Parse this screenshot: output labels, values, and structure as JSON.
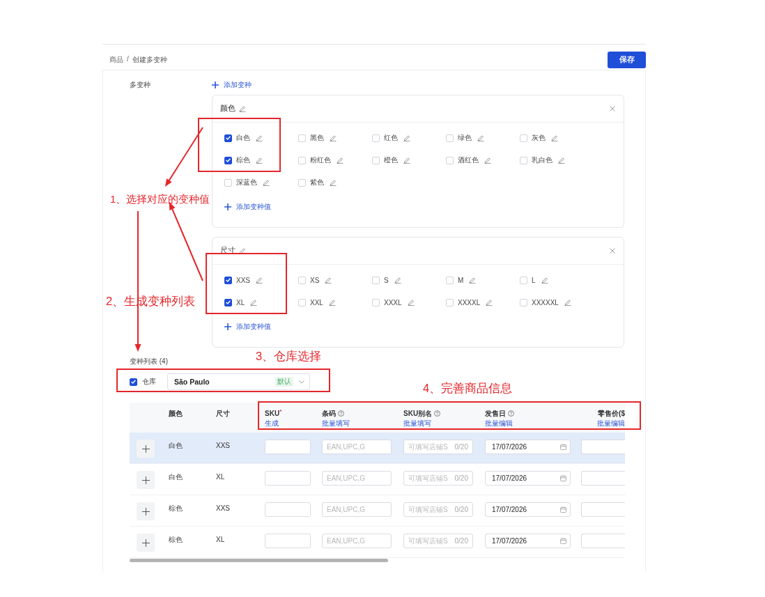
{
  "breadcrumb": {
    "items": [
      "商品",
      "创建多变种"
    ],
    "separator": "/"
  },
  "save_button": "保存",
  "variants": {
    "label": "多变种",
    "add_variant": "添加变种",
    "groups": [
      {
        "name": "颜色",
        "options": [
          {
            "label": "白色",
            "checked": true
          },
          {
            "label": "黑色",
            "checked": false
          },
          {
            "label": "红色",
            "checked": false
          },
          {
            "label": "绿色",
            "checked": false
          },
          {
            "label": "灰色",
            "checked": false
          },
          {
            "label": "棕色",
            "checked": true
          },
          {
            "label": "粉红色",
            "checked": false
          },
          {
            "label": "橙色",
            "checked": false
          },
          {
            "label": "酒红色",
            "checked": false
          },
          {
            "label": "乳白色",
            "checked": false
          },
          {
            "label": "深蓝色",
            "checked": false
          },
          {
            "label": "紫色",
            "checked": false
          }
        ],
        "add_value": "添加变种值"
      },
      {
        "name": "尺寸",
        "options": [
          {
            "label": "XXS",
            "checked": true
          },
          {
            "label": "XS",
            "checked": false
          },
          {
            "label": "S",
            "checked": false
          },
          {
            "label": "M",
            "checked": false
          },
          {
            "label": "L",
            "checked": false
          },
          {
            "label": "XL",
            "checked": true
          },
          {
            "label": "XXL",
            "checked": false
          },
          {
            "label": "XXXL",
            "checked": false
          },
          {
            "label": "XXXXL",
            "checked": false
          },
          {
            "label": "XXXXXL",
            "checked": false
          }
        ],
        "add_value": "添加变种值"
      }
    ]
  },
  "variant_list": {
    "title": "变种列表 (4)",
    "warehouse": {
      "label": "仓库",
      "checked": true,
      "value": "São Paulo",
      "tag": "默认"
    },
    "table": {
      "columns": [
        {
          "label": "颜色",
          "help": false
        },
        {
          "label": "尺寸",
          "help": false
        },
        {
          "label": "SKU",
          "mark": "*",
          "help": false,
          "action": "生成"
        },
        {
          "label": "条码",
          "help": true,
          "action": "批量填写"
        },
        {
          "label": "SKU别名",
          "help": true,
          "action": "批量填写"
        },
        {
          "label": "发售日",
          "help": true,
          "action": "批量编辑"
        },
        {
          "label": "零售价($",
          "help": false,
          "action": "批量编辑"
        }
      ],
      "rows": [
        {
          "highlighted": true,
          "cells": [
            "白色",
            "XXS"
          ],
          "barcode": {
            "placeholder": "EAN,UPC,G"
          },
          "alias": {
            "placeholder": "可填写店铺S",
            "counter": "0/20"
          },
          "release_date": "17/07/2026"
        },
        {
          "highlighted": false,
          "cells": [
            "白色",
            "XL"
          ],
          "barcode": {
            "placeholder": "EAN,UPC,G"
          },
          "alias": {
            "placeholder": "可填写店铺S",
            "counter": "0/20"
          },
          "release_date": "17/07/2026"
        },
        {
          "highlighted": false,
          "cells": [
            "棕色",
            "XXS"
          ],
          "barcode": {
            "placeholder": "EAN,UPC,G"
          },
          "alias": {
            "placeholder": "可填写店铺S",
            "counter": "0/20"
          },
          "release_date": "17/07/2026"
        },
        {
          "highlighted": false,
          "cells": [
            "棕色",
            "XL"
          ],
          "barcode": {
            "placeholder": "EAN,UPC,G"
          },
          "alias": {
            "placeholder": "可填写店铺S",
            "counter": "0/20"
          },
          "release_date": "17/07/2026"
        }
      ]
    }
  },
  "annotations": [
    "1、选择对应的变种值",
    "2、生成变种列表",
    "3、仓库选择",
    "4、完善商品信息"
  ]
}
